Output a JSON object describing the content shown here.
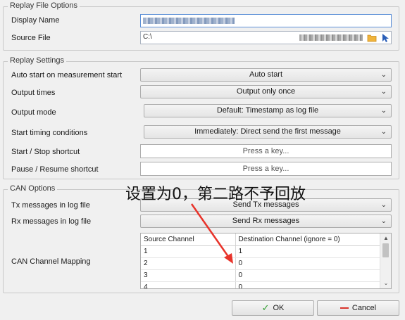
{
  "replay_file_options": {
    "title": "Replay File Options",
    "display_name_label": "Display Name",
    "source_file_label": "Source File",
    "source_file_value_prefix": "C:\\"
  },
  "replay_settings": {
    "title": "Replay Settings",
    "auto_start_label": "Auto start on measurement start",
    "auto_start_value": "Auto start",
    "output_times_label": "Output times",
    "output_times_value": "Output only once",
    "output_mode_label": "Output mode",
    "output_mode_value": "Default: Timestamp as log file",
    "start_timing_label": "Start timing conditions",
    "start_timing_value": "Immediately: Direct send the first message",
    "start_stop_label": "Start / Stop shortcut",
    "start_stop_value": "Press a key...",
    "pause_resume_label": "Pause / Resume shortcut",
    "pause_resume_value": "Press a key..."
  },
  "can_options": {
    "title": "CAN Options",
    "tx_label": "Tx messages in log file",
    "tx_value": "Send Tx messages",
    "rx_label": "Rx messages in log file",
    "rx_value": "Send Rx messages",
    "mapping_label": "CAN Channel Mapping",
    "mapping_headers": [
      "Source Channel",
      "Destination Channel (ignore = 0)"
    ],
    "mapping_rows": [
      [
        "1",
        "1"
      ],
      [
        "2",
        "0"
      ],
      [
        "3",
        "0"
      ],
      [
        "4",
        "0"
      ]
    ]
  },
  "annotation": {
    "text": "设置为0，第二路不予回放",
    "arrow_color": "#e8332a"
  },
  "buttons": {
    "ok": "OK",
    "cancel": "Cancel"
  },
  "colors": {
    "ok_check": "#2f9e2f",
    "cancel_dash": "#d9342b",
    "folder": "#f0b43c",
    "cursor": "#2b5fb8"
  }
}
